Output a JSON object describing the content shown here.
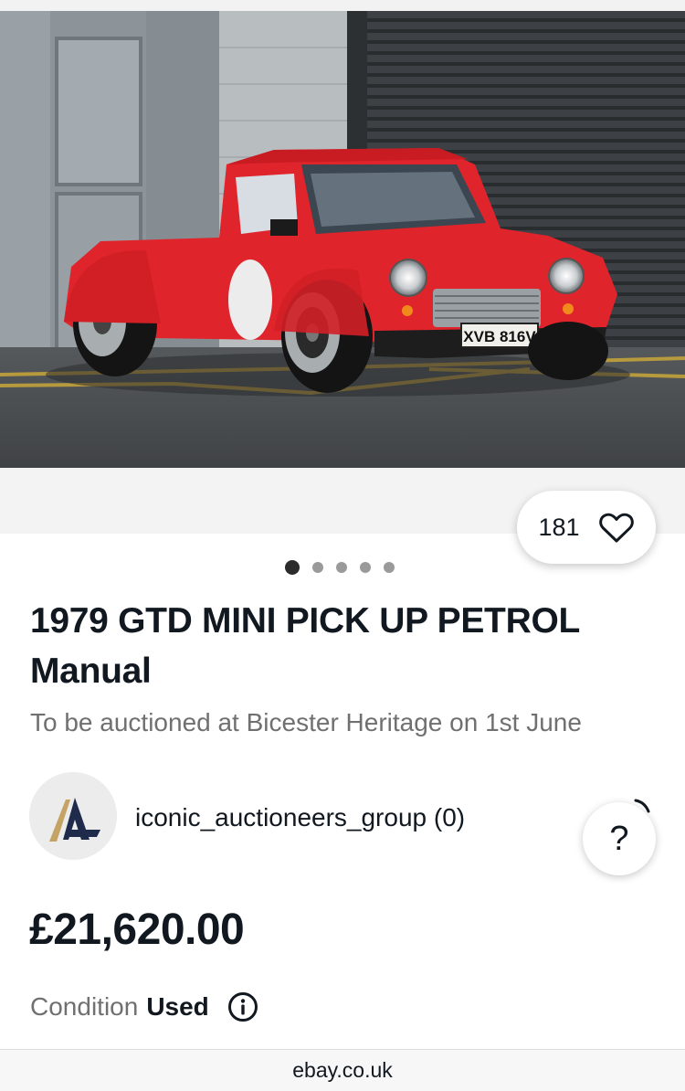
{
  "listing": {
    "image_alt": "1979 GTD Mini pick up in red",
    "plate_text": "XVB 816V",
    "photo_count": 5,
    "active_photo": 1,
    "watch_count": "181",
    "title": "1979 GTD MINI PICK UP PETROL Manual",
    "subtitle": "To be auctioned at Bicester Heritage on 1st June",
    "price": "£21,620.00",
    "condition_label": "Condition",
    "condition_value": "Used"
  },
  "seller": {
    "name": "iconic_auctioneers_group (0)",
    "avatar_colors": {
      "navy": "#1f2b4a",
      "gold": "#c4a365"
    }
  },
  "help": {
    "label": "?"
  },
  "browser": {
    "url": "ebay.co.uk"
  },
  "icons": {
    "heart": "heart-outline-icon",
    "info": "info-circle-icon",
    "help": "question-icon"
  },
  "colors": {
    "car_red": "#e0242b",
    "text_primary": "#111820",
    "text_secondary": "#707070"
  }
}
